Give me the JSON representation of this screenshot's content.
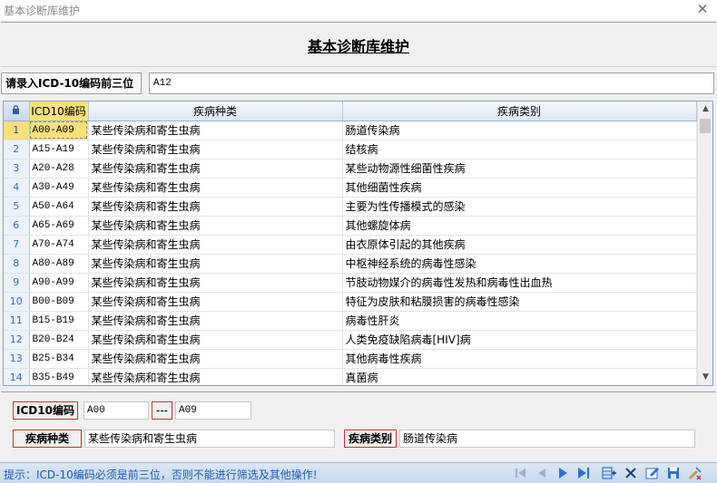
{
  "window": {
    "title": "基本诊断库维护",
    "close_glyph": "✕"
  },
  "header": {
    "title": "基本诊断库维护"
  },
  "search": {
    "label": "请录入ICD-10编码前三位",
    "value": "A12"
  },
  "grid": {
    "corner_icon": "lock-icon",
    "columns": [
      "ICD10编码",
      "疾病种类",
      "疾病类别"
    ],
    "rows": [
      {
        "n": "1",
        "code": "A00-A09",
        "kind": "某些传染病和寄生虫病",
        "cat": "肠道传染病"
      },
      {
        "n": "2",
        "code": "A15-A19",
        "kind": "某些传染病和寄生虫病",
        "cat": "结核病"
      },
      {
        "n": "3",
        "code": "A20-A28",
        "kind": "某些传染病和寄生虫病",
        "cat": "某些动物源性细菌性疾病"
      },
      {
        "n": "4",
        "code": "A30-A49",
        "kind": "某些传染病和寄生虫病",
        "cat": "其他细菌性疾病"
      },
      {
        "n": "5",
        "code": "A50-A64",
        "kind": "某些传染病和寄生虫病",
        "cat": "主要为性传播模式的感染"
      },
      {
        "n": "6",
        "code": "A65-A69",
        "kind": "某些传染病和寄生虫病",
        "cat": "其他螺旋体病"
      },
      {
        "n": "7",
        "code": "A70-A74",
        "kind": "某些传染病和寄生虫病",
        "cat": "由衣原体引起的其他疾病"
      },
      {
        "n": "8",
        "code": "A80-A89",
        "kind": "某些传染病和寄生虫病",
        "cat": "中枢神经系统的病毒性感染"
      },
      {
        "n": "9",
        "code": "A90-A99",
        "kind": "某些传染病和寄生虫病",
        "cat": "节肢动物媒介的病毒性发热和病毒性出血热"
      },
      {
        "n": "10",
        "code": "B00-B09",
        "kind": "某些传染病和寄生虫病",
        "cat": "特征为皮肤和粘膜损害的病毒性感染"
      },
      {
        "n": "11",
        "code": "B15-B19",
        "kind": "某些传染病和寄生虫病",
        "cat": "病毒性肝炎"
      },
      {
        "n": "12",
        "code": "B20-B24",
        "kind": "某些传染病和寄生虫病",
        "cat": "人类免疫缺陷病毒[HIV]病"
      },
      {
        "n": "13",
        "code": "B25-B34",
        "kind": "某些传染病和寄生虫病",
        "cat": "其他病毒性疾病"
      },
      {
        "n": "14",
        "code": "B35-B49",
        "kind": "某些传染病和寄生虫病",
        "cat": "真菌病"
      }
    ]
  },
  "edit": {
    "code_label": "ICD10编码",
    "code_from": "A00",
    "range_sep": "---",
    "code_to": "A09",
    "kind_label": "疾病种类",
    "kind_value": "某些传染病和寄生虫病",
    "cat_label": "疾病类别",
    "cat_value": "肠道传染病"
  },
  "status": {
    "tip": "提示：ICD-10编码必须是前三位，否则不能进行筛选及其他操作!",
    "toolbar_icons": [
      "first-record-icon",
      "prev-record-icon",
      "next-record-icon",
      "last-record-icon",
      "insert-record-icon",
      "delete-record-icon",
      "edit-record-icon",
      "save-icon",
      "cancel-edit-icon"
    ]
  },
  "colors": {
    "selection": "#f9e07a",
    "grid_header": "#dde7f3",
    "status_text": "#1d5bb5",
    "label_border": "#c83030",
    "nav_blue": "#2f6fd6"
  }
}
